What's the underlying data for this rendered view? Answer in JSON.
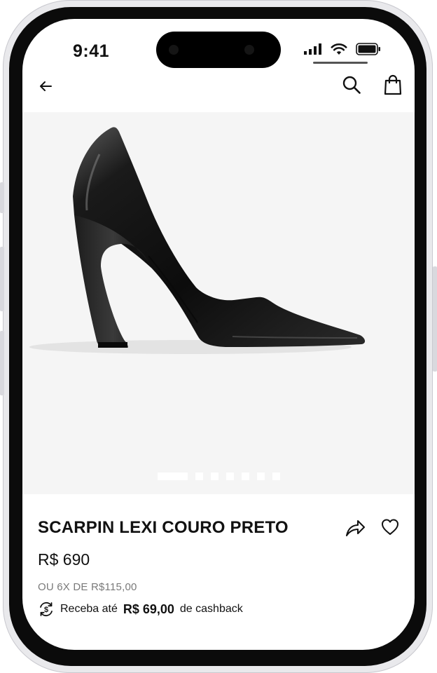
{
  "status_bar": {
    "time": "9:41"
  },
  "product": {
    "name": "SCARPIN LEXI COURO PRETO",
    "price": "R$ 690",
    "installments": "OU 6X DE R$115,00",
    "cashback": {
      "prefix": "Receba até",
      "amount": "R$ 69,00",
      "suffix": "de cashback"
    }
  },
  "gallery": {
    "image_count": 7,
    "active_index": 0
  },
  "icons": {
    "back": "arrow-left-icon",
    "search": "search-icon",
    "bag": "shopping-bag-icon",
    "share": "share-icon",
    "favorite": "heart-icon",
    "cashback": "cashback-icon"
  }
}
